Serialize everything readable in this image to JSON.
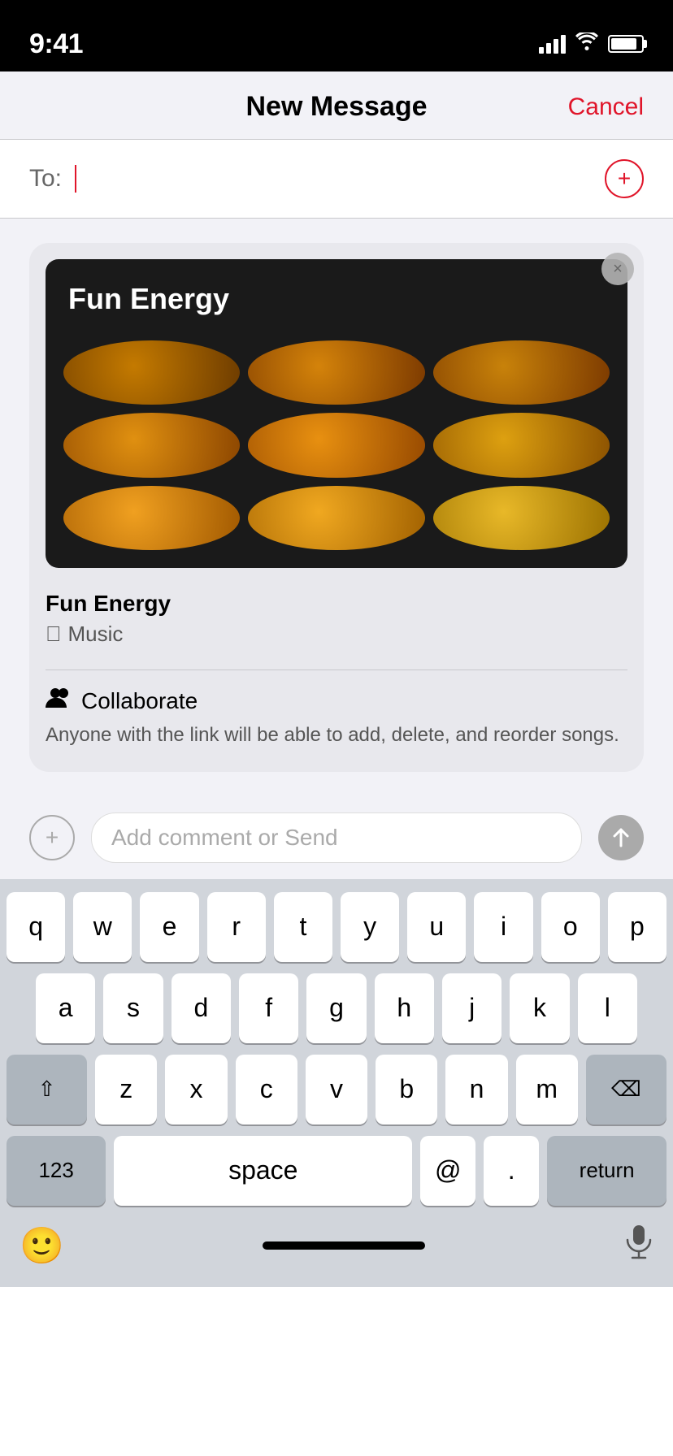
{
  "statusBar": {
    "time": "9:41",
    "batteryLevel": 85
  },
  "navBar": {
    "title": "New Message",
    "cancelLabel": "Cancel"
  },
  "toField": {
    "label": "To:",
    "placeholder": ""
  },
  "musicCard": {
    "albumTitle": "Fun Energy",
    "albumName": "Fun Energy",
    "service": "Music",
    "collaborateTitle": "Collaborate",
    "collaborateDesc": "Anyone with the link will be able to add, delete, and reorder songs.",
    "closeLabel": "×"
  },
  "commentBar": {
    "placeholder": "Add comment or Send",
    "addLabel": "+",
    "sendLabel": "↑"
  },
  "keyboard": {
    "row1": [
      "q",
      "w",
      "e",
      "r",
      "t",
      "y",
      "u",
      "i",
      "o",
      "p"
    ],
    "row2": [
      "a",
      "s",
      "d",
      "f",
      "g",
      "h",
      "j",
      "k",
      "l"
    ],
    "row3": [
      "z",
      "x",
      "c",
      "v",
      "b",
      "n",
      "m"
    ],
    "shiftLabel": "⇧",
    "deleteLabel": "⌫",
    "numbersLabel": "123",
    "spaceLabel": "space",
    "atLabel": "@",
    "dotLabel": ".",
    "returnLabel": "return",
    "emojiLabel": "🙂",
    "micLabel": "🎤"
  },
  "colors": {
    "accent": "#e0152a",
    "keyboardBg": "#d1d5db",
    "cardBg": "#e8e8ed"
  }
}
